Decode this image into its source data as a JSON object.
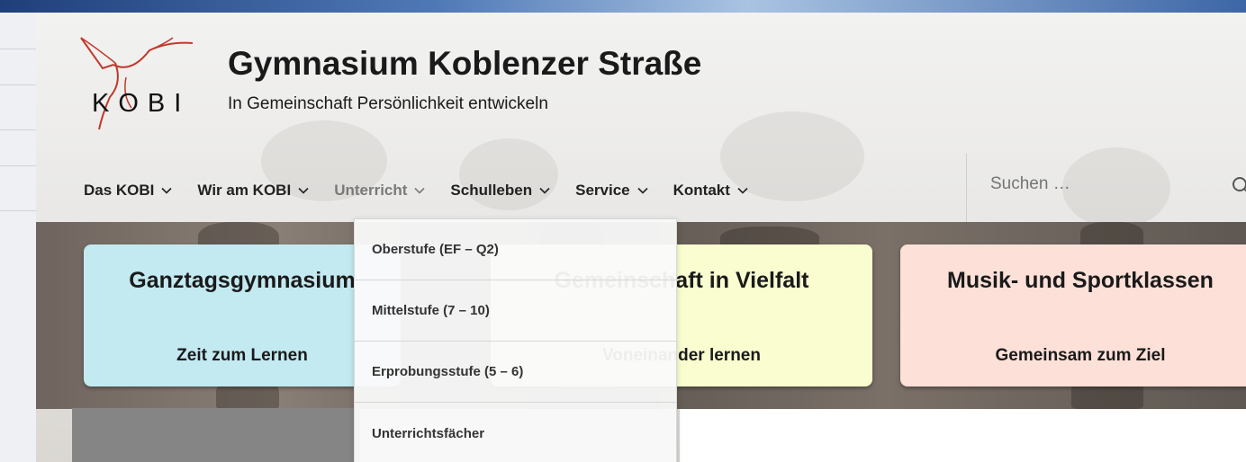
{
  "site": {
    "logo_text": "KOBI",
    "title": "Gymnasium Koblenzer Straße",
    "tagline": "In Gemeinschaft Persönlichkeit entwickeln"
  },
  "nav": {
    "items": [
      {
        "label": "Das KOBI"
      },
      {
        "label": "Wir am KOBI"
      },
      {
        "label": "Unterricht"
      },
      {
        "label": "Schulleben"
      },
      {
        "label": "Service"
      },
      {
        "label": "Kontakt"
      }
    ]
  },
  "search": {
    "placeholder": "Suchen …"
  },
  "dropdown": {
    "items": [
      {
        "label": "Oberstufe (EF – Q2)"
      },
      {
        "label": "Mittelstufe (7 – 10)"
      },
      {
        "label": "Erprobungsstufe (5 – 6)"
      },
      {
        "label": "Unterrichtsfächer"
      }
    ]
  },
  "cards": [
    {
      "title": "Ganztagsgymnasium",
      "subtitle": "Zeit zum Lernen",
      "color": "#c3e9f1"
    },
    {
      "title": "Gemeinschaft in Vielfalt",
      "subtitle": "Voneinander lernen",
      "color": "#fafdcf"
    },
    {
      "title": "Musik- und Sportklassen",
      "subtitle": "Gemeinsam zum Ziel",
      "color": "#fde0d8"
    }
  ],
  "colors": {
    "logo_red": "#c0392b",
    "active_nav": "#7a7a7a"
  }
}
